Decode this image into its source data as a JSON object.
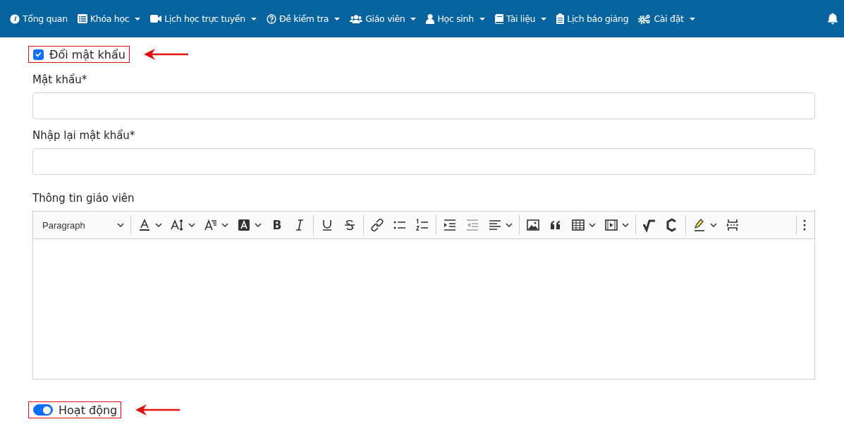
{
  "navbar": {
    "items": [
      {
        "label": "Tổng quan",
        "kind": "gauge",
        "dropdown": false
      },
      {
        "label": "Khóa học",
        "kind": "list",
        "dropdown": true
      },
      {
        "label": "Lịch học trực tuyến",
        "kind": "video",
        "dropdown": true
      },
      {
        "label": "Đề kiểm tra",
        "kind": "question",
        "dropdown": true
      },
      {
        "label": "Giáo viên",
        "kind": "users",
        "dropdown": true
      },
      {
        "label": "Học sinh",
        "kind": "user",
        "dropdown": true
      },
      {
        "label": "Tài liệu",
        "kind": "book",
        "dropdown": true
      },
      {
        "label": "Lịch báo giảng",
        "kind": "clipboard",
        "dropdown": false
      },
      {
        "label": "Cài đặt",
        "kind": "cogs",
        "dropdown": true
      }
    ]
  },
  "change_password": {
    "label": "Đổi mật khẩu",
    "checked": true,
    "highlighted": true
  },
  "fields": [
    {
      "label": "Mật khẩu*"
    },
    {
      "label": "Nhập lại mật khẩu*"
    }
  ],
  "editor": {
    "label": "Thông tin giáo viên",
    "heading_select": "Paragraph",
    "toolbar": [
      {
        "kind": "font-color",
        "dropdown": true,
        "disabled": false
      },
      {
        "kind": "font-size",
        "dropdown": true,
        "disabled": false
      },
      {
        "kind": "font-family",
        "dropdown": true,
        "disabled": false
      },
      {
        "kind": "background-color",
        "dropdown": true,
        "disabled": false
      },
      {
        "kind": "bold",
        "label": "B",
        "dropdown": false,
        "disabled": false
      },
      {
        "kind": "italic",
        "dropdown": false,
        "disabled": false
      },
      {
        "kind": "sep"
      },
      {
        "kind": "underline",
        "dropdown": false,
        "disabled": false
      },
      {
        "kind": "strike",
        "dropdown": false,
        "disabled": false
      },
      {
        "kind": "sep"
      },
      {
        "kind": "link",
        "dropdown": false,
        "disabled": false
      },
      {
        "kind": "bullets",
        "dropdown": false,
        "disabled": false
      },
      {
        "kind": "numbers",
        "dropdown": false,
        "disabled": false
      },
      {
        "kind": "sep"
      },
      {
        "kind": "indent",
        "dropdown": false,
        "disabled": false
      },
      {
        "kind": "outdent",
        "dropdown": false,
        "disabled": true
      },
      {
        "kind": "align",
        "dropdown": true,
        "disabled": false
      },
      {
        "kind": "sep"
      },
      {
        "kind": "image",
        "dropdown": false,
        "disabled": false
      },
      {
        "kind": "quote",
        "dropdown": false,
        "disabled": false
      },
      {
        "kind": "table",
        "dropdown": true,
        "disabled": false
      },
      {
        "kind": "media",
        "dropdown": true,
        "disabled": false
      },
      {
        "kind": "sep"
      },
      {
        "kind": "math",
        "dropdown": false,
        "disabled": false
      },
      {
        "kind": "chem",
        "dropdown": false,
        "disabled": false
      },
      {
        "kind": "sep"
      },
      {
        "kind": "highlight",
        "dropdown": true,
        "disabled": false
      },
      {
        "kind": "page-break",
        "dropdown": false,
        "disabled": false
      },
      {
        "kind": "gap"
      },
      {
        "kind": "sep"
      },
      {
        "kind": "more",
        "dropdown": false,
        "disabled": false
      }
    ]
  },
  "active": {
    "label": "Hoạt động",
    "on": true,
    "highlighted": true
  }
}
